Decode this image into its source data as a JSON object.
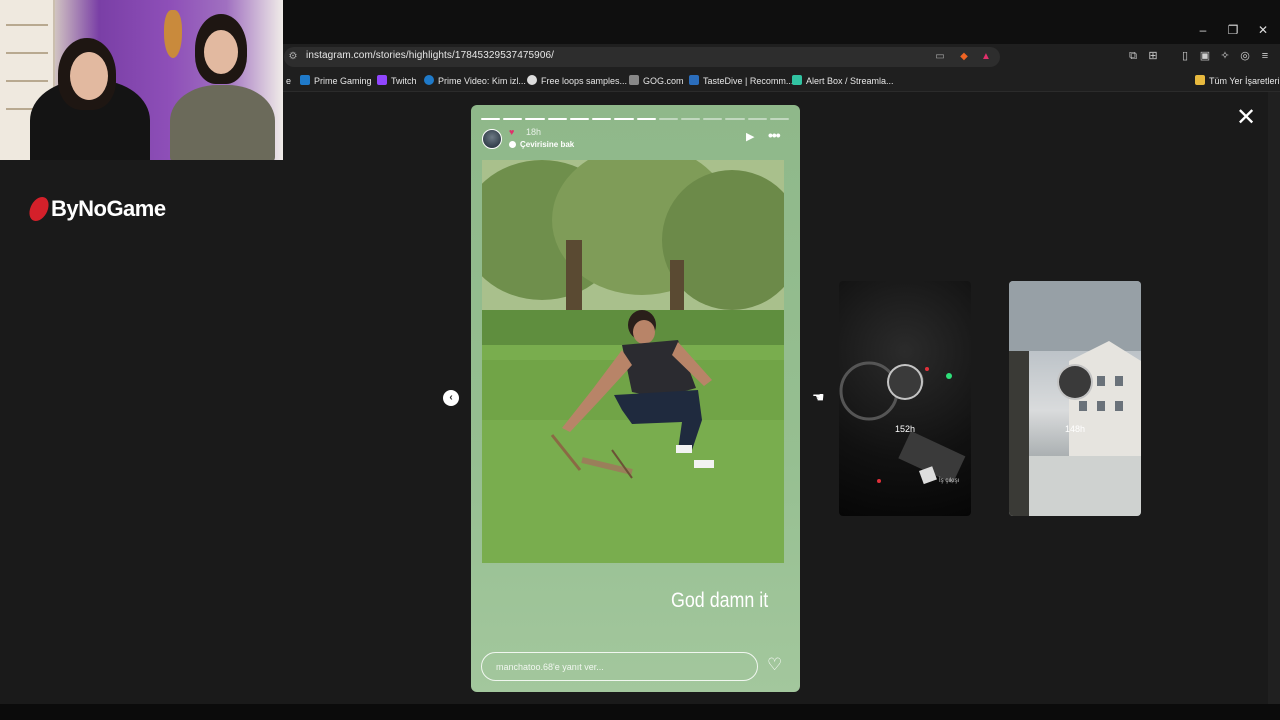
{
  "browser": {
    "url": "instagram.com/stories/highlights/17845329537475906/",
    "window_buttons": [
      "–",
      "❐",
      "✕"
    ],
    "bookmarks": [
      {
        "label": "e",
        "color": "#555555"
      },
      {
        "label": "Prime Gaming",
        "color": "#1f7ac9"
      },
      {
        "label": "Twitch",
        "color": "#9146ff"
      },
      {
        "label": "Prime Video: Kim izl...",
        "color": "#1f7ac9"
      },
      {
        "label": "Free loops samples...",
        "color": "#dddddd"
      },
      {
        "label": "GOG.com",
        "color": "#888888"
      },
      {
        "label": "TasteDive | Recomm...",
        "color": "#2b6ebd"
      },
      {
        "label": "Alert Box / Streamla...",
        "color": "#31c3a2"
      }
    ],
    "bookmarks_folder": "Tüm Yer İşaretleri"
  },
  "overlay": {
    "logo": "ByNoGame"
  },
  "story": {
    "time": "18h",
    "translate_label": "Çevirisine bak",
    "caption": "God damn it",
    "reply_placeholder": "manchatoo.68'e yanıt ver...",
    "progress_total": 14,
    "progress_done": 8
  },
  "next_stories": [
    {
      "time": "152h",
      "small_text": "İş çıkışı"
    },
    {
      "time": "148h"
    }
  ],
  "icons": {
    "close": "close-icon",
    "prev": "chevron-left-icon",
    "next": "chevron-right-icon",
    "play": "play-icon",
    "more": "more-icon",
    "heart": "heart-icon"
  }
}
